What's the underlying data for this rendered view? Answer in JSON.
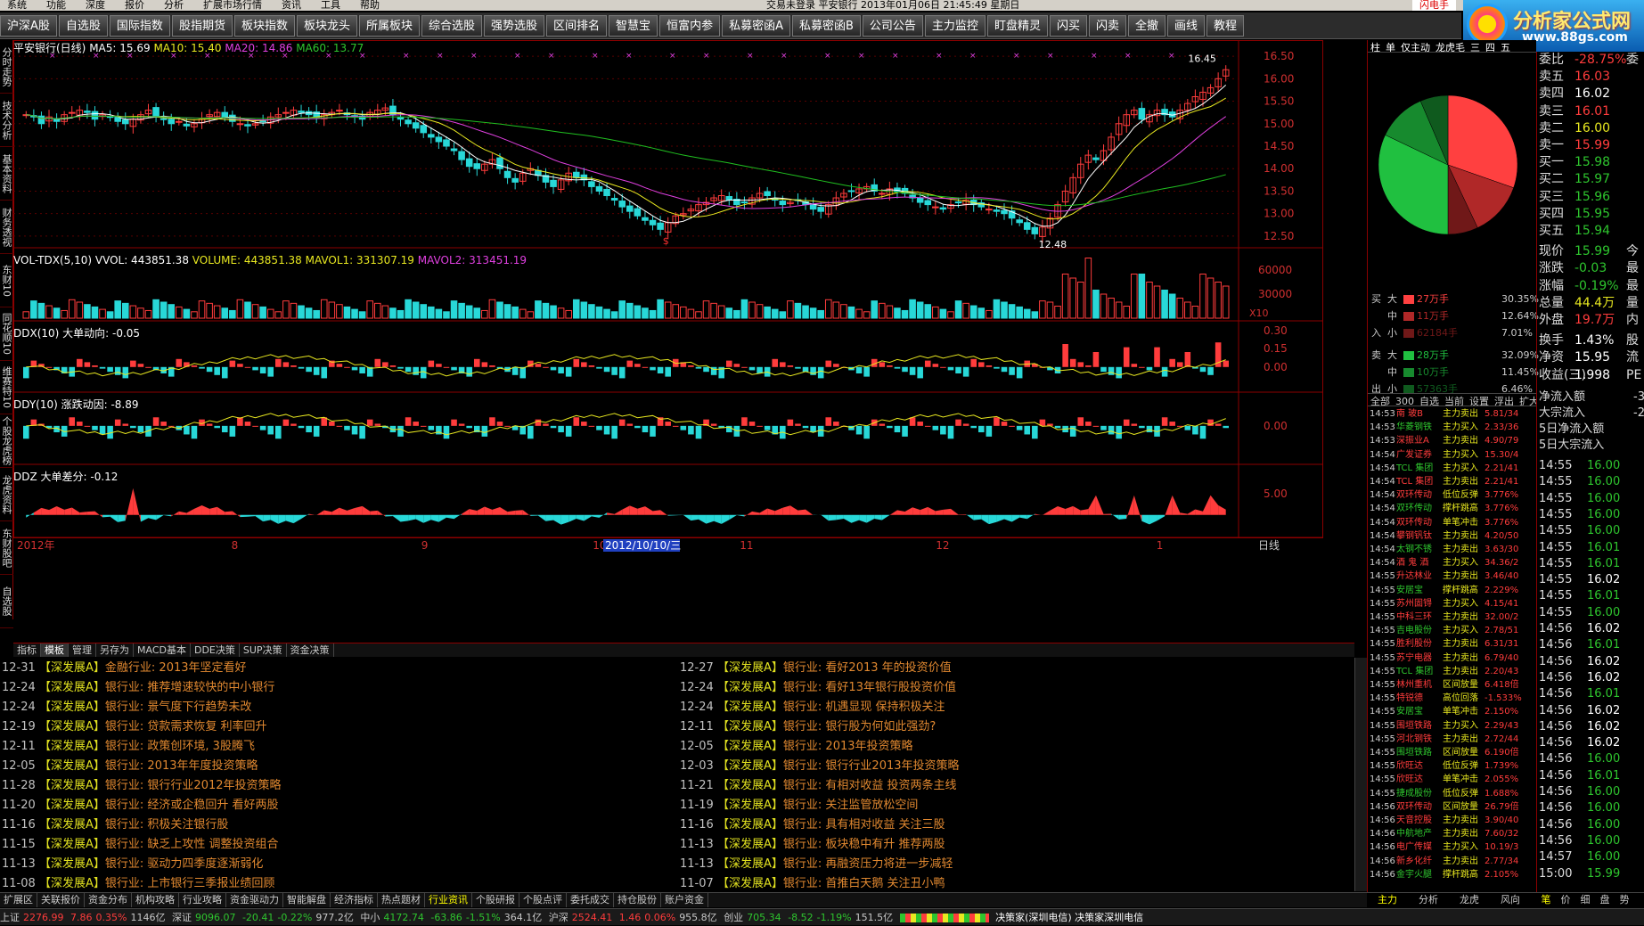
{
  "menu": {
    "items": [
      "系统",
      "功能",
      "深度",
      "报价",
      "分析",
      "扩展市场行情",
      "资讯",
      "工具",
      "帮助"
    ],
    "title": "交易未登录   平安银行  2013年01月06日 21:45:49 星期日",
    "flash": "闪电手"
  },
  "toolbar": [
    "沪深A股",
    "自选股",
    "国际指数",
    "股指期货",
    "板块指数",
    "板块龙头",
    "所属板块",
    "综合选股",
    "强势选股",
    "区间排名",
    "智慧宝",
    "恒富内参",
    "私募密函A",
    "私募密函B",
    "公司公告",
    "主力监控",
    "盯盘精灵",
    "闪买",
    "闪卖",
    "全撤",
    "画线",
    "教程"
  ],
  "logo": {
    "name": "分析家公式网",
    "url": "www.88gs.com"
  },
  "lefttabs": [
    "分时走势",
    "技术分析",
    "基本资料",
    "财务透视",
    "东财10",
    "同花顺10",
    "维赛特10",
    "个股龙虎榜",
    "龙虎资料",
    "东财股吧",
    "自选股"
  ],
  "price_chart": {
    "title": "平安银行(日线)",
    "ma5": "MA5: 15.69",
    "ma10": "MA10: 15.40",
    "ma20": "MA20: 14.86",
    "ma60": "MA60: 13.77",
    "high_label": "16.45",
    "low_label": "12.48",
    "s_marker": "$",
    "yaxis": [
      "16.50",
      "16.00",
      "15.50",
      "15.00",
      "14.50",
      "14.00",
      "13.50",
      "13.00",
      "12.50"
    ],
    "ymin": 12.3,
    "ymax": 16.7
  },
  "volume": {
    "title": "VOL-TDX(5,10)",
    "vol": "VVOL: 443851.38",
    "volume": "VOLUME: 443851.38",
    "mavol1": "MAVOL1: 331307.19",
    "mavol2": "MAVOL2: 313451.19",
    "yaxis": [
      "60000",
      "30000"
    ],
    "unit": "X10"
  },
  "ddx": {
    "title": "DDX(10) 大单动向: -0.05",
    "yaxis": [
      "0.30",
      "0.15",
      "0.00"
    ]
  },
  "ddy": {
    "title": "DDY(10) 涨跌动因: -8.89",
    "yaxis": [
      "0.00"
    ]
  },
  "ddz": {
    "title": "DDZ 大单差分: -0.12",
    "yaxis": [
      "5.00"
    ]
  },
  "xaxis": {
    "labels": [
      "2012年",
      "8",
      "9",
      "10",
      "2012/10/10/三",
      "11",
      "12",
      "1"
    ],
    "period": "日线"
  },
  "chart_data": [
    {
      "type": "candlestick",
      "title": "平安银行(日线)",
      "ylim": [
        12.3,
        16.7
      ],
      "close": [
        15.2,
        15.15,
        15.0,
        15.15,
        15.05,
        15.2,
        15.25,
        15.3,
        15.25,
        15.1,
        15.2,
        15.15,
        15.05,
        15.0,
        15.1,
        15.2,
        15.3,
        15.15,
        15.1,
        15.0,
        15.05,
        14.95,
        15.0,
        15.1,
        15.2,
        15.25,
        15.15,
        15.05,
        15.0,
        14.95,
        15.0,
        15.05,
        15.15,
        15.2,
        15.25,
        15.3,
        15.25,
        15.2,
        15.15,
        15.2,
        15.25,
        15.3,
        15.2,
        15.15,
        15.1,
        15.25,
        15.3,
        15.35,
        15.2,
        15.1,
        15.0,
        14.9,
        14.8,
        14.7,
        14.6,
        14.5,
        14.4,
        14.2,
        14.05,
        14.0,
        14.1,
        14.2,
        14.0,
        13.8,
        13.7,
        13.9,
        14.0,
        13.85,
        13.7,
        13.6,
        13.75,
        13.9,
        13.8,
        13.75,
        13.6,
        13.5,
        13.4,
        13.3,
        13.15,
        13.05,
        12.95,
        12.85,
        12.75,
        12.65,
        12.8,
        12.95,
        13.0,
        13.1,
        13.2,
        13.25,
        13.35,
        13.4,
        13.3,
        13.2,
        13.25,
        13.35,
        13.45,
        13.4,
        13.3,
        13.2,
        13.25,
        13.3,
        13.2,
        13.1,
        13.05,
        13.2,
        13.35,
        13.45,
        13.5,
        13.55,
        13.6,
        13.5,
        13.45,
        13.55,
        13.5,
        13.45,
        13.35,
        13.25,
        13.2,
        13.15,
        13.1,
        13.2,
        13.25,
        13.3,
        13.2,
        13.15,
        13.1,
        13.05,
        13.0,
        12.9,
        12.8,
        12.65,
        12.55,
        12.7,
        12.9,
        13.2,
        13.5,
        13.8,
        14.1,
        14.3,
        14.2,
        14.4,
        14.7,
        15.0,
        15.2,
        15.3,
        15.1,
        15.2,
        15.3,
        15.2,
        15.15,
        15.3,
        15.45,
        15.6,
        15.7,
        15.8,
        16.0,
        16.2
      ],
      "ma5": 15.69,
      "ma10": 15.4,
      "ma20": 14.86,
      "ma60": 13.77
    },
    {
      "type": "bar",
      "title": "VOL-TDX(5,10)",
      "ylim": [
        0,
        80000
      ]
    },
    {
      "type": "bar",
      "title": "DDX(10)",
      "ylim": [
        -0.15,
        0.35
      ]
    },
    {
      "type": "bar",
      "title": "DDY(10)",
      "ylim": [
        -10,
        10
      ]
    },
    {
      "type": "area",
      "title": "DDZ",
      "ylim": [
        -3,
        8
      ]
    }
  ],
  "tabs": [
    "指标",
    "模板",
    "管理",
    "另存为",
    "MACD基本",
    "DDE决策",
    "SUP决策",
    "资金决策"
  ],
  "tabs_active": 1,
  "news_left": [
    {
      "d": "12-31",
      "s": "【深发展A】",
      "t": "金融行业: 2013年坚定看好"
    },
    {
      "d": "12-24",
      "s": "【深发展A】",
      "t": "银行业: 推荐增速较快的中小银行"
    },
    {
      "d": "12-24",
      "s": "【深发展A】",
      "t": "银行业: 景气度下行趋势未改"
    },
    {
      "d": "12-19",
      "s": "【深发展A】",
      "t": "银行业: 贷款需求恢复 利率回升"
    },
    {
      "d": "12-11",
      "s": "【深发展A】",
      "t": "银行业: 政策创环境, 3股腾飞"
    },
    {
      "d": "12-05",
      "s": "【深发展A】",
      "t": "银行业: 2013年年度投资策略"
    },
    {
      "d": "11-28",
      "s": "【深发展A】",
      "t": "银行业: 银行行业2012年投资策略"
    },
    {
      "d": "11-20",
      "s": "【深发展A】",
      "t": "银行业: 经济或企稳回升 看好两股"
    },
    {
      "d": "11-16",
      "s": "【深发展A】",
      "t": "银行业: 积极关注银行股"
    },
    {
      "d": "11-15",
      "s": "【深发展A】",
      "t": "银行业: 缺乏上攻性 调整投资组合"
    },
    {
      "d": "11-13",
      "s": "【深发展A】",
      "t": "银行业: 驱动力四季度逐渐弱化"
    },
    {
      "d": "11-08",
      "s": "【深发展A】",
      "t": "银行业: 上市银行三季报业绩回顾"
    }
  ],
  "news_right": [
    {
      "d": "12-27",
      "s": "【深发展A】",
      "t": "银行业: 看好2013 年的投资价值"
    },
    {
      "d": "12-24",
      "s": "【深发展A】",
      "t": "银行业: 看好13年银行股投资价值"
    },
    {
      "d": "12-24",
      "s": "【深发展A】",
      "t": "银行业: 机遇显现 保持积极关注"
    },
    {
      "d": "12-11",
      "s": "【深发展A】",
      "t": "银行业: 银行股为何如此强劲?"
    },
    {
      "d": "12-05",
      "s": "【深发展A】",
      "t": "银行业: 2013年投资策略"
    },
    {
      "d": "12-03",
      "s": "【深发展A】",
      "t": "银行业: 银行行业2013年投资策略"
    },
    {
      "d": "11-21",
      "s": "【深发展A】",
      "t": "银行业: 有相对收益 投资两条主线"
    },
    {
      "d": "11-19",
      "s": "【深发展A】",
      "t": "银行业: 关注监管放松空间"
    },
    {
      "d": "11-16",
      "s": "【深发展A】",
      "t": "银行业: 具有相对收益 关注三股"
    },
    {
      "d": "11-13",
      "s": "【深发展A】",
      "t": "银行业: 板块稳中有升 推荐两股"
    },
    {
      "d": "11-13",
      "s": "【深发展A】",
      "t": "银行业: 再融资压力将进一步减轻"
    },
    {
      "d": "11-07",
      "s": "【深发展A】",
      "t": "银行业: 首推白天鹅 关注丑小鸭"
    }
  ],
  "bottomtabs": [
    "扩展区",
    "关联报价",
    "资金分布",
    "机构攻略",
    "行业攻略",
    "资金驱动力",
    "智能解盘",
    "经济指标",
    "热点题材",
    "行业资讯",
    "个股研报",
    "个股点评",
    "委托成交",
    "持仓股份",
    "账户资金"
  ],
  "bottomtabs_active": 9,
  "status": {
    "sh_label": "上证",
    "sh_val": "2276.99",
    "sh_chg": "7.86",
    "sh_pct": "0.35%",
    "sh_amt": "1146亿",
    "sz_label": "深证",
    "sz_val": "9096.07",
    "sz_chg": "-20.41",
    "sz_pct": "-0.22%",
    "sz_amt": "977.2亿",
    "zx_label": "中小",
    "zx_val": "4172.74",
    "zx_chg": "-63.86",
    "zx_pct": "-1.51%",
    "zx_amt": "364.1亿",
    "hs_label": "沪深",
    "hs_val": "2524.41",
    "hs_chg": "1.46",
    "hs_pct": "0.06%",
    "hs_amt": "955.8亿",
    "cy_label": "创业",
    "cy_val": "705.34",
    "cy_chg": "-8.52",
    "cy_pct": "-1.19%",
    "cy_amt": "151.5亿",
    "isp": "决策家(深圳电信) 决策家深圳电信"
  },
  "midtabs": [
    "柱",
    "单",
    "仅主动",
    "龙虎毛",
    "三",
    "四",
    "五"
  ],
  "pie": {
    "slices": [
      {
        "name": "大买",
        "value": 30.35,
        "color": "#ff4040"
      },
      {
        "name": "中买",
        "value": 12.64,
        "color": "#b02828"
      },
      {
        "name": "小买",
        "value": 7.01,
        "color": "#701818"
      },
      {
        "name": "大卖",
        "value": 32.09,
        "color": "#20c040"
      },
      {
        "name": "中卖",
        "value": 11.45,
        "color": "#178a2e"
      },
      {
        "name": "小卖",
        "value": 6.46,
        "color": "#0f5a1e"
      }
    ]
  },
  "flows": [
    {
      "c1": "买",
      "c2": "大",
      "amt": "27万手",
      "pct": "30.35%",
      "color": "#ff4040"
    },
    {
      "c1": "",
      "c2": "中",
      "amt": "11万手",
      "pct": "12.64%",
      "color": "#b02828"
    },
    {
      "c1": "入",
      "c2": "小",
      "amt": "62184手",
      "pct": "7.01%",
      "color": "#701818"
    },
    {
      "c1": "卖",
      "c2": "大",
      "amt": "28万手",
      "pct": "32.09%",
      "color": "#20c040"
    },
    {
      "c1": "",
      "c2": "中",
      "amt": "10万手",
      "pct": "11.45%",
      "color": "#178a2e"
    },
    {
      "c1": "出",
      "c2": "小",
      "amt": "57363手",
      "pct": "6.46%",
      "color": "#0f5a1e"
    }
  ],
  "dealtabs": [
    "全部",
    "300",
    "自选",
    "当前",
    "设置",
    "浮出",
    "扩大"
  ],
  "deals": [
    {
      "t": "14:53",
      "n": "南 玻B",
      "a": "主力卖出",
      "v": "5.81/34"
    },
    {
      "t": "14:53",
      "n": "华菱钢铁",
      "a": "主力买入",
      "v": "2.33/36"
    },
    {
      "t": "14:53",
      "n": "深振业A",
      "a": "主力卖出",
      "v": "4.90/79"
    },
    {
      "t": "14:54",
      "n": "广发证券",
      "a": "主力买入",
      "v": "15.30/4"
    },
    {
      "t": "14:54",
      "n": "TCL 集团",
      "a": "主力买入",
      "v": "2.21/41"
    },
    {
      "t": "14:54",
      "n": "TCL 集团",
      "a": "主力卖出",
      "v": "2.21/41"
    },
    {
      "t": "14:54",
      "n": "双环传动",
      "a": "低位反弹",
      "v": "3.776%"
    },
    {
      "t": "14:54",
      "n": "双环传动",
      "a": "撑杆跳高",
      "v": "3.776%"
    },
    {
      "t": "14:54",
      "n": "双环传动",
      "a": "单笔冲击",
      "v": "3.776%"
    },
    {
      "t": "14:54",
      "n": "攀钢钒钛",
      "a": "主力卖出",
      "v": "4.20/50"
    },
    {
      "t": "14:54",
      "n": "太钢不锈",
      "a": "主力卖出",
      "v": "3.63/30"
    },
    {
      "t": "14:54",
      "n": "酒 鬼 酒",
      "a": "主力买入",
      "v": "34.36/2"
    },
    {
      "t": "14:55",
      "n": "升达林业",
      "a": "主力卖出",
      "v": "3.46/40"
    },
    {
      "t": "14:55",
      "n": "安居宝",
      "a": "撑杆跳高",
      "v": "2.229%"
    },
    {
      "t": "14:55",
      "n": "苏州固锝",
      "a": "主力买入",
      "v": "4.15/41"
    },
    {
      "t": "14:55",
      "n": "中科三环",
      "a": "主力卖出",
      "v": "32.00/2"
    },
    {
      "t": "14:55",
      "n": "吉电股份",
      "a": "主力买入",
      "v": "2.78/51"
    },
    {
      "t": "14:55",
      "n": "胜利股份",
      "a": "主力卖出",
      "v": "6.31/31"
    },
    {
      "t": "14:55",
      "n": "苏宁电器",
      "a": "主力卖出",
      "v": "6.79/40"
    },
    {
      "t": "14:55",
      "n": "TCL 集团",
      "a": "主力卖出",
      "v": "2.20/43"
    },
    {
      "t": "14:55",
      "n": "林州重机",
      "a": "区间放量",
      "v": "6.418倍"
    },
    {
      "t": "14:55",
      "n": "特锐德",
      "a": "高位回落",
      "v": "-1.533%"
    },
    {
      "t": "14:55",
      "n": "安居宝",
      "a": "单笔冲击",
      "v": "2.150%"
    },
    {
      "t": "14:55",
      "n": "围垣铁路",
      "a": "主力买入",
      "v": "2.29/43"
    },
    {
      "t": "14:55",
      "n": "河北钢铁",
      "a": "主力卖出",
      "v": "2.72/44"
    },
    {
      "t": "14:55",
      "n": "围垣铁路",
      "a": "区间放量",
      "v": "6.190倍"
    },
    {
      "t": "14:55",
      "n": "欣旺达",
      "a": "低位反弹",
      "v": "1.739%"
    },
    {
      "t": "14:55",
      "n": "欣旺达",
      "a": "单笔冲击",
      "v": "2.055%"
    },
    {
      "t": "14:55",
      "n": "捷成股份",
      "a": "低位反弹",
      "v": "1.688%"
    },
    {
      "t": "14:56",
      "n": "双环传动",
      "a": "区间放量",
      "v": "26.79倍"
    },
    {
      "t": "14:56",
      "n": "天音控股",
      "a": "主力卖出",
      "v": "3.90/40"
    },
    {
      "t": "14:56",
      "n": "中航地产",
      "a": "主力卖出",
      "v": "7.60/32"
    },
    {
      "t": "14:56",
      "n": "电广传媒",
      "a": "主力买入",
      "v": "10.19/3"
    },
    {
      "t": "14:56",
      "n": "新乡化纤",
      "a": "主力卖出",
      "v": "2.77/34"
    },
    {
      "t": "14:56",
      "n": "金宇火腿",
      "a": "撑杆跳高",
      "v": "2.105%"
    }
  ],
  "midbottom": [
    "主力",
    "分析",
    "龙虎",
    "风向"
  ],
  "quote": [
    {
      "l": "委比",
      "v": "-28.75%",
      "x": "委",
      "c": "red"
    },
    {
      "l": "卖五",
      "v": "16.03",
      "x": "",
      "c": "red"
    },
    {
      "l": "卖四",
      "v": "16.02",
      "x": "",
      "c": "wht"
    },
    {
      "l": "卖三",
      "v": "16.01",
      "x": "",
      "c": "red"
    },
    {
      "l": "卖二",
      "v": "16.00",
      "x": "",
      "c": "yel"
    },
    {
      "l": "卖一",
      "v": "15.99",
      "x": "",
      "c": "red"
    },
    {
      "l": "买一",
      "v": "15.98",
      "x": "",
      "c": "grn"
    },
    {
      "l": "买二",
      "v": "15.97",
      "x": "",
      "c": "grn"
    },
    {
      "l": "买三",
      "v": "15.96",
      "x": "",
      "c": "grn"
    },
    {
      "l": "买四",
      "v": "15.95",
      "x": "",
      "c": "grn"
    },
    {
      "l": "买五",
      "v": "15.94",
      "x": "",
      "c": "grn"
    },
    {
      "l": "现价",
      "v": "15.99",
      "x": "今",
      "c": "grn"
    },
    {
      "l": "涨跌",
      "v": "-0.03",
      "x": "最",
      "c": "grn"
    },
    {
      "l": "涨幅",
      "v": "-0.19%",
      "x": "最",
      "c": "grn"
    },
    {
      "l": "总量",
      "v": "44.4万",
      "x": "量",
      "c": "yel"
    },
    {
      "l": "外盘",
      "v": "19.7万",
      "x": "内",
      "c": "red"
    },
    {
      "l": "换手",
      "v": "1.43%",
      "x": "股",
      "c": "wht"
    },
    {
      "l": "净资",
      "v": "15.95",
      "x": "流",
      "c": "wht"
    },
    {
      "l": "收益(三)",
      "v": "1.998",
      "x": "PE",
      "c": "wht"
    }
  ],
  "flowinfo": [
    {
      "l": "净流入额",
      "v": "-3"
    },
    {
      "l": "大宗流入",
      "v": "-2"
    },
    {
      "l": "5日净流入额",
      "v": ""
    },
    {
      "l": "5日大宗流入",
      "v": ""
    }
  ],
  "ticks": [
    {
      "t": "14:55",
      "p": "16.00",
      "c": "grn"
    },
    {
      "t": "14:55",
      "p": "16.00",
      "c": "grn"
    },
    {
      "t": "14:55",
      "p": "16.00",
      "c": "grn"
    },
    {
      "t": "14:55",
      "p": "16.00",
      "c": "grn"
    },
    {
      "t": "14:55",
      "p": "16.00",
      "c": "grn"
    },
    {
      "t": "14:55",
      "p": "16.01",
      "c": "grn"
    },
    {
      "t": "14:55",
      "p": "16.01",
      "c": "grn"
    },
    {
      "t": "14:55",
      "p": "16.02",
      "c": "wht"
    },
    {
      "t": "14:55",
      "p": "16.01",
      "c": "grn"
    },
    {
      "t": "14:55",
      "p": "16.00",
      "c": "grn"
    },
    {
      "t": "14:56",
      "p": "16.02",
      "c": "wht"
    },
    {
      "t": "14:56",
      "p": "16.01",
      "c": "grn"
    },
    {
      "t": "14:56",
      "p": "16.02",
      "c": "wht"
    },
    {
      "t": "14:56",
      "p": "16.02",
      "c": "wht"
    },
    {
      "t": "14:56",
      "p": "16.01",
      "c": "grn"
    },
    {
      "t": "14:56",
      "p": "16.02",
      "c": "wht"
    },
    {
      "t": "14:56",
      "p": "16.02",
      "c": "wht"
    },
    {
      "t": "14:56",
      "p": "16.02",
      "c": "wht"
    },
    {
      "t": "14:56",
      "p": "16.00",
      "c": "grn"
    },
    {
      "t": "14:56",
      "p": "16.01",
      "c": "grn"
    },
    {
      "t": "14:56",
      "p": "16.00",
      "c": "grn"
    },
    {
      "t": "14:56",
      "p": "16.00",
      "c": "grn"
    },
    {
      "t": "14:56",
      "p": "16.00",
      "c": "grn"
    },
    {
      "t": "14:56",
      "p": "16.00",
      "c": "grn"
    },
    {
      "t": "14:57",
      "p": "16.00",
      "c": "grn"
    },
    {
      "t": "15:00",
      "p": "15.99",
      "c": "grn"
    }
  ],
  "rightbottom": [
    "笔",
    "价",
    "细",
    "盘",
    "势"
  ],
  "colors": {
    "up": "#ff3c3c",
    "down": "#28d8d8",
    "ma5": "#ffffff",
    "ma10": "#e8e820",
    "ma20": "#e040e0",
    "ma60": "#20c020",
    "frame": "#8b0000"
  }
}
